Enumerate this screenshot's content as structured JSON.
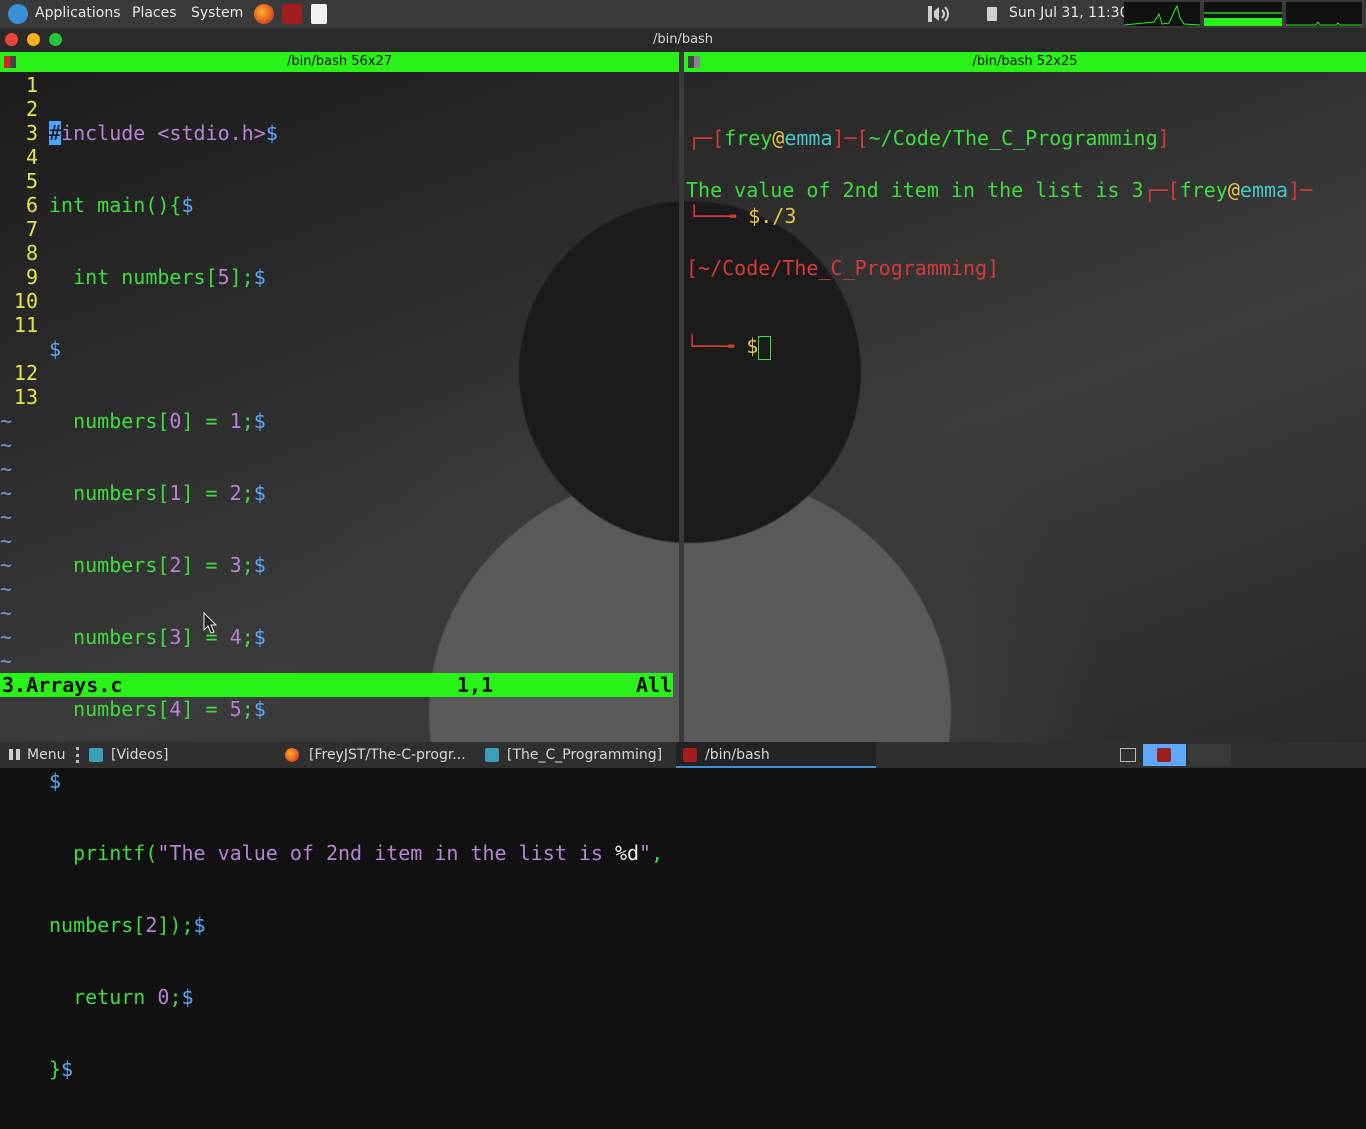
{
  "top_panel": {
    "menus": [
      "Applications",
      "Places",
      "System"
    ],
    "clock": "Sun Jul 31, 11:30"
  },
  "window": {
    "title": "/bin/bash"
  },
  "left_pane": {
    "header": "/bin/bash 56x27",
    "vim": {
      "filename": "3.Arrays.c",
      "position": "1,1",
      "scroll": "All",
      "line_numbers": [
        "1",
        "2",
        "3",
        "4",
        "5",
        "6",
        "7",
        "8",
        "9",
        "10",
        "11",
        "12",
        "13"
      ],
      "code": {
        "l1_a": "#",
        "l1_b": "include",
        "l1_c": " <stdio.h>",
        "l1_d": "$",
        "l2_a": "int",
        "l2_b": " main(){",
        "l2_c": "$",
        "l3_a": "int",
        "l3_b": " numbers[",
        "l3_c": "5",
        "l3_d": "];",
        "l3_e": "$",
        "l4": "$",
        "l5_a": "numbers[",
        "l5_b": "0",
        "l5_c": "] = ",
        "l5_d": "1",
        "l5_e": ";",
        "l5_f": "$",
        "l6_a": "numbers[",
        "l6_b": "1",
        "l6_c": "] = ",
        "l6_d": "2",
        "l6_e": ";",
        "l6_f": "$",
        "l7_a": "numbers[",
        "l7_b": "2",
        "l7_c": "] = ",
        "l7_d": "3",
        "l7_e": ";",
        "l7_f": "$",
        "l8_a": "numbers[",
        "l8_b": "3",
        "l8_c": "] = ",
        "l8_d": "4",
        "l8_e": ";",
        "l8_f": "$",
        "l9_a": "numbers[",
        "l9_b": "4",
        "l9_c": "] = ",
        "l9_d": "5",
        "l9_e": ";",
        "l9_f": "$",
        "l10": "$",
        "l11_a": "printf(",
        "l11_b": "\"The value of 2nd item in the list is ",
        "l11_c": "%d",
        "l11_d": "\"",
        "l11_e": ",",
        "l11w_a": "numbers[",
        "l11w_b": "2",
        "l11w_c": "]);",
        "l11w_d": "$",
        "l12_a": "return",
        "l12_b": " ",
        "l12_c": "0",
        "l12_d": ";",
        "l12_e": "$",
        "l13_a": "}",
        "l13_b": "$"
      },
      "tilde": "~"
    }
  },
  "right_pane": {
    "header": "/bin/bash 52x25",
    "prompt": {
      "open": "┌─[",
      "user": "frey",
      "at": "@",
      "host": "emma",
      "mid": "]─[",
      "path": "~/Code/The_C_Programming",
      "close": "]",
      "corner": "└──╼ ",
      "dollar": "$",
      "command": "./3"
    },
    "output": "The value of 2nd item in the list is 3",
    "prompt2": {
      "open": "┌─[",
      "user": "frey",
      "at": "@",
      "host": "emma",
      "dash": "]─",
      "path_line": "[~/Code/The_C_Programming]",
      "corner": "└──╼ ",
      "dollar": "$"
    }
  },
  "taskbar": {
    "menu": "Menu",
    "items": [
      "[Videos]",
      "[FreyJST/The-C-progr...",
      "[The_C_Programming]",
      "/bin/bash"
    ]
  },
  "colors": {
    "accent_green": "#29f219",
    "panel_bg": "#3a3a3a"
  }
}
